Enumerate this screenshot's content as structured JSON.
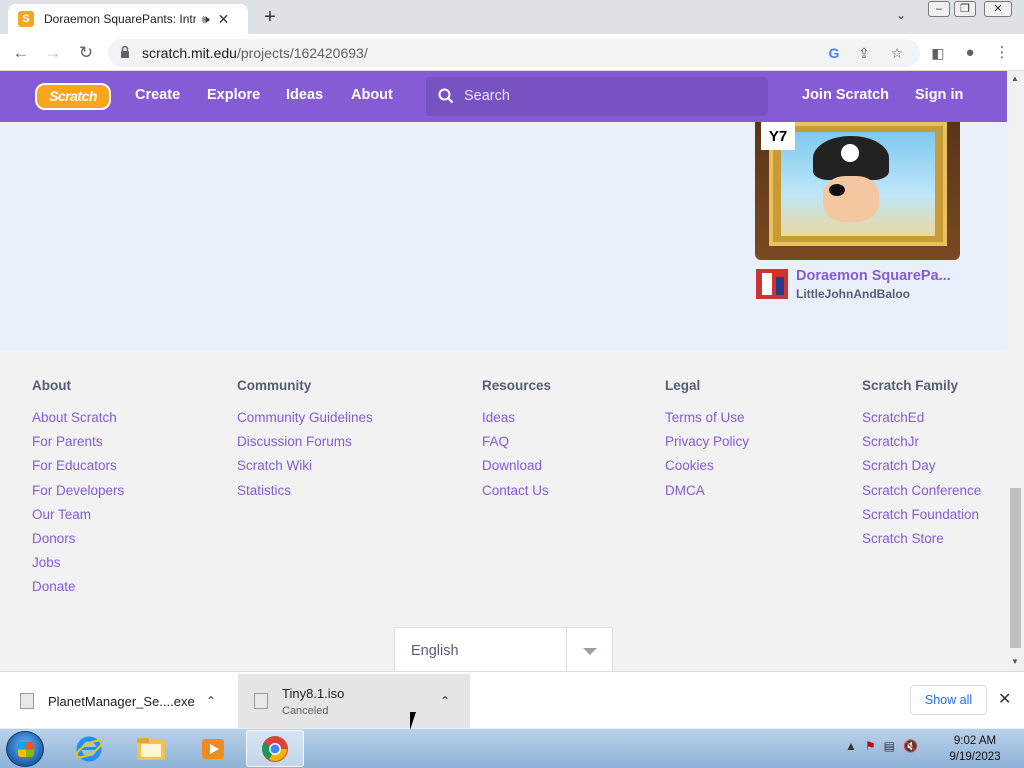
{
  "browser": {
    "tab_title": "Doraemon SquarePants: Intr",
    "tab_favicon_letter": "S",
    "url_host": "scratch.mit.edu",
    "url_path": "/projects/162420693/"
  },
  "scratch_nav": {
    "logo_text": "Scratch",
    "links": [
      "Create",
      "Explore",
      "Ideas",
      "About"
    ],
    "search_placeholder": "Search",
    "join": "Join Scratch",
    "signin": "Sign in"
  },
  "project_card": {
    "thumb_badge": "Y7",
    "title": "Doraemon SquarePa...",
    "author": "LittleJohnAndBaloo"
  },
  "footer": {
    "columns": [
      {
        "heading": "About",
        "links": [
          "About Scratch",
          "For Parents",
          "For Educators",
          "For Developers",
          "Our Team",
          "Donors",
          "Jobs",
          "Donate"
        ]
      },
      {
        "heading": "Community",
        "links": [
          "Community Guidelines",
          "Discussion Forums",
          "Scratch Wiki",
          "Statistics"
        ]
      },
      {
        "heading": "Resources",
        "links": [
          "Ideas",
          "FAQ",
          "Download",
          "Contact Us"
        ]
      },
      {
        "heading": "Legal",
        "links": [
          "Terms of Use",
          "Privacy Policy",
          "Cookies",
          "DMCA"
        ]
      },
      {
        "heading": "Scratch Family",
        "links": [
          "ScratchEd",
          "ScratchJr",
          "Scratch Day",
          "Scratch Conference",
          "Scratch Foundation",
          "Scratch Store"
        ]
      }
    ],
    "language": "English"
  },
  "downloads": {
    "items": [
      {
        "name": "PlanetManager_Se....exe",
        "status": ""
      },
      {
        "name": "Tiny8.1.iso",
        "status": "Canceled"
      }
    ],
    "show_all": "Show all"
  },
  "taskbar": {
    "time": "9:02 AM",
    "date": "9/19/2023"
  },
  "colors": {
    "scratch_purple": "#855cd6",
    "footer_bg": "#f2f2f2",
    "content_bg": "#e9f0fb"
  }
}
